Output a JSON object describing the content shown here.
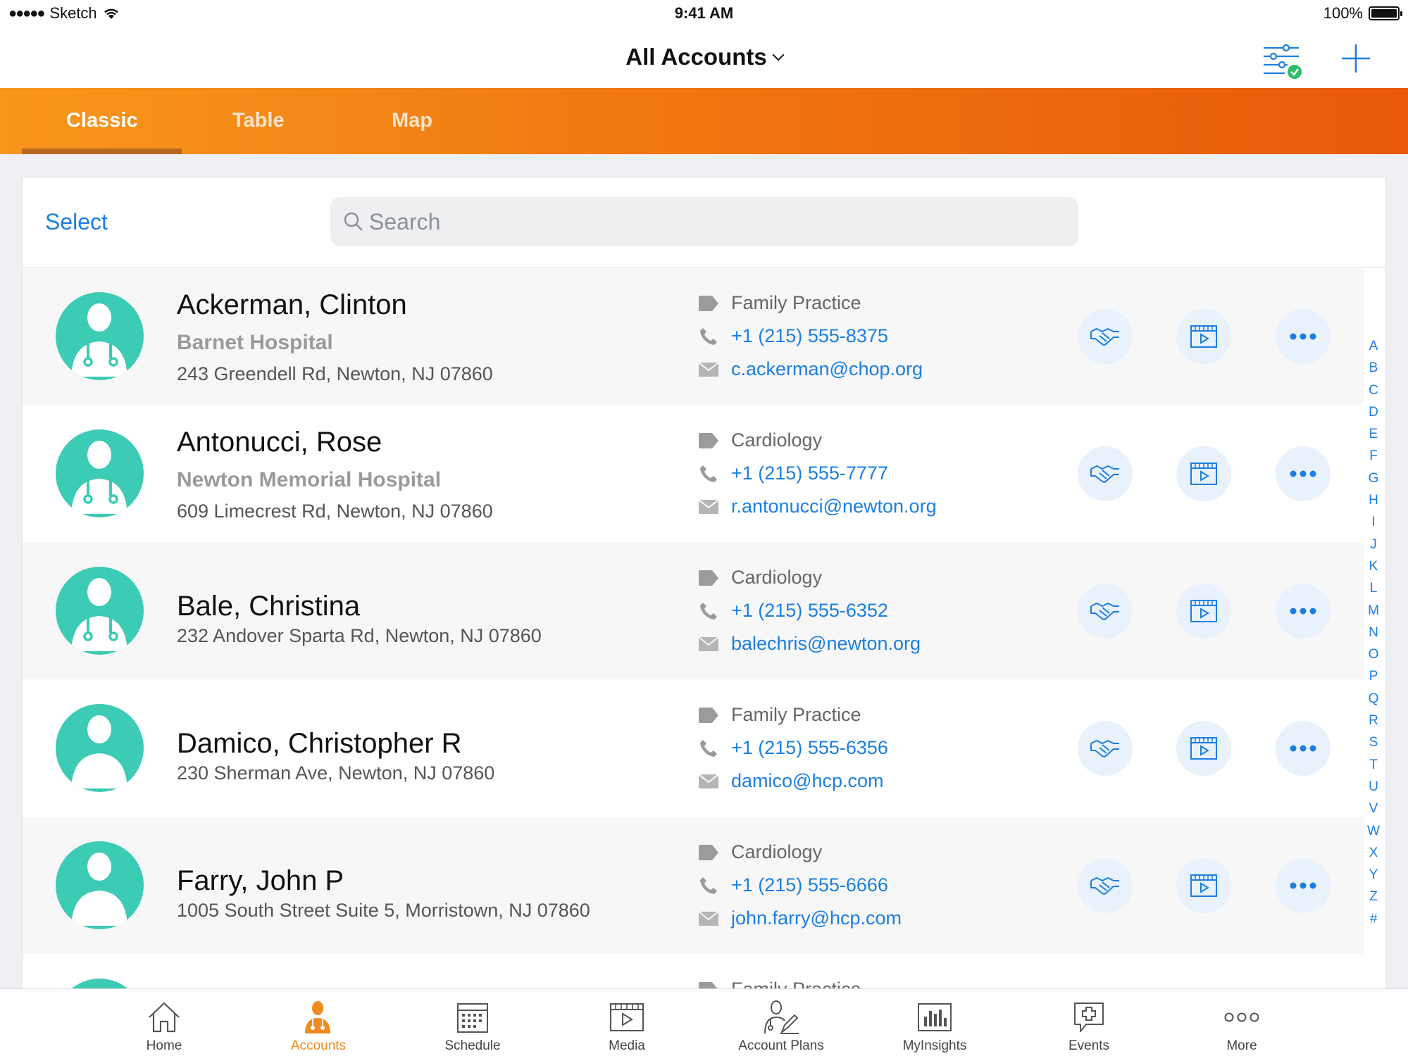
{
  "status_bar": {
    "carrier": "Sketch",
    "time": "9:41 AM",
    "battery": "100%"
  },
  "nav": {
    "title": "All Accounts"
  },
  "view_tabs": [
    {
      "label": "Classic",
      "active": true
    },
    {
      "label": "Table",
      "active": false
    },
    {
      "label": "Map",
      "active": false
    }
  ],
  "list_header": {
    "select_label": "Select",
    "search_placeholder": "Search"
  },
  "accounts": [
    {
      "name": "Ackerman, Clinton",
      "hospital": "Barnet Hospital",
      "address": "243 Greendell Rd, Newton, NJ 07860",
      "specialty": "Family Practice",
      "phone": "+1 (215) 555-8375",
      "email": "c.ackerman@chop.org",
      "avatar": "doctor-avatar-icon"
    },
    {
      "name": "Antonucci, Rose",
      "hospital": "Newton Memorial Hospital",
      "address": "609 Limecrest Rd, Newton, NJ 07860",
      "specialty": "Cardiology",
      "phone": "+1 (215) 555-7777",
      "email": "r.antonucci@newton.org",
      "avatar": "doctor-avatar-icon"
    },
    {
      "name": "Bale, Christina",
      "hospital": "",
      "address": "232 Andover Sparta Rd, Newton, NJ 07860",
      "specialty": "Cardiology",
      "phone": "+1 (215) 555-6352",
      "email": "balechris@newton.org",
      "avatar": "doctor-avatar-icon"
    },
    {
      "name": "Damico, Christopher R",
      "hospital": "",
      "address": "230 Sherman Ave, Newton, NJ 07860",
      "specialty": "Family Practice",
      "phone": "+1 (215) 555-6356",
      "email": "damico@hcp.com",
      "avatar": "person-avatar-icon"
    },
    {
      "name": "Farry, John P",
      "hospital": "",
      "address": "1005 South Street Suite 5, Morristown, NJ 07860",
      "specialty": "Cardiology",
      "phone": "+1 (215) 555-6666",
      "email": "john.farry@hcp.com",
      "avatar": "person-avatar-icon"
    },
    {
      "name": "",
      "hospital": "",
      "address": "",
      "specialty": "Family Practice",
      "phone": "",
      "email": "",
      "avatar": "doctor-avatar-icon"
    }
  ],
  "alpha_index": [
    "A",
    "B",
    "C",
    "D",
    "E",
    "F",
    "G",
    "H",
    "I",
    "J",
    "K",
    "L",
    "M",
    "N",
    "O",
    "P",
    "Q",
    "R",
    "S",
    "T",
    "U",
    "V",
    "W",
    "X",
    "Y",
    "Z",
    "#"
  ],
  "bottom_tabs": [
    {
      "label": "Home",
      "icon": "home-icon",
      "active": false
    },
    {
      "label": "Accounts",
      "icon": "accounts-icon",
      "active": true
    },
    {
      "label": "Schedule",
      "icon": "calendar-icon",
      "active": false
    },
    {
      "label": "Media",
      "icon": "media-icon",
      "active": false
    },
    {
      "label": "Account Plans",
      "icon": "account-plans-icon",
      "active": false
    },
    {
      "label": "MyInsights",
      "icon": "insights-chart-icon",
      "active": false
    },
    {
      "label": "Events",
      "icon": "events-icon",
      "active": false
    },
    {
      "label": "More",
      "icon": "more-dots-icon",
      "active": false
    }
  ],
  "colors": {
    "accent_blue": "#1b7fe0",
    "avatar_teal": "#3ccbb4",
    "orange_start": "#f8971b",
    "orange_end": "#e85a08",
    "active_tab": "#f08a1c"
  }
}
